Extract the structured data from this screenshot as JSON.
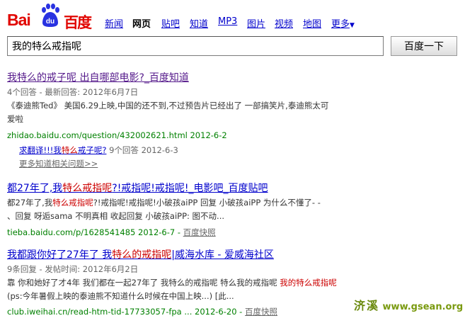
{
  "logo": {
    "bai": "Bai",
    "du": "du",
    "cn": "百度"
  },
  "nav": [
    {
      "label": "新闻",
      "current": false
    },
    {
      "label": "网页",
      "current": true
    },
    {
      "label": "贴吧",
      "current": false
    },
    {
      "label": "知道",
      "current": false
    },
    {
      "label": "MP3",
      "current": false
    },
    {
      "label": "图片",
      "current": false
    },
    {
      "label": "视频",
      "current": false
    },
    {
      "label": "地图",
      "current": false
    },
    {
      "label": "更多",
      "current": false
    }
  ],
  "nav_more_arrow": "▼",
  "search": {
    "value": "我的特么戒指呢",
    "button": "百度一下"
  },
  "results": [
    {
      "title_a": "我特么的戒子呢 出自哪部电影?_百度知道",
      "meta": "4个回答 - 最新回答: 2012年6月7日",
      "snippet_1": "《泰迪熊Ted》 美国6.29上映,中国的还不到,不过预告片已经出了 一部搞笑片,泰迪熊太可",
      "snippet_2": "爱啦",
      "url": "zhidao.baidu.com/question/432002621.html  2012-6-2",
      "sub_a": "求翻译!!!我",
      "sub_em": "特么",
      "sub_b": "戒子呢?",
      "sub_meta": " 9个回答  2012-6-3",
      "more": "更多知道相关问题>>"
    },
    {
      "title_a": "都27年了,我",
      "title_em": "特么戒指呢",
      "title_b": "?!戒指呢!戒指呢!_电影吧_百度贴吧",
      "snip_a": "都27年了,我",
      "snip_em": "特么戒指呢",
      "snip_b": "?!戒指呢!戒指呢!小破孩aiPP 回复 小破孩aiPP 为什么不懂了- -",
      "snippet_2": "、回复 呀逅sama 不明真相 收起回复 小破孩aiPP: 图不动...",
      "url": "tieba.baidu.com/p/1628541485 2012-6-7 - ",
      "snap": "百度快照"
    },
    {
      "title_a": "我都跟你好了27年了 我",
      "title_em": "特么的戒指呢",
      "title_b": "|威海水库 - 爱威海社区",
      "meta": "9条回复 - 发帖时间: 2012年6月2日",
      "snip_a": "靠 你和她好了才4年 我们都在一起27年了 我特么的戒指呢 特么我的戒指呢 ",
      "snip_em": "我的特么戒指呢",
      "snippet_2": "(ps:今年暑假上映的泰迪熊不知道什么时候在中国上映...) [此...",
      "url": "club.iweihai.cn/read-htm-tid-17733057-fpa ... 2012-6-20 - ",
      "snap": "百度快照"
    }
  ],
  "watermark": {
    "cn": "济溪",
    "url": "www.gsean.org"
  }
}
